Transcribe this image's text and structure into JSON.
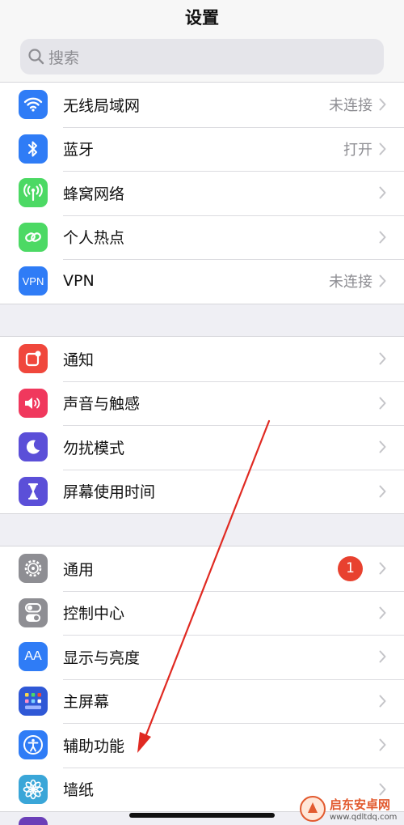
{
  "header": {
    "title": "设置"
  },
  "search": {
    "placeholder": "搜索"
  },
  "groups": [
    {
      "items": [
        {
          "label": "无线局域网",
          "value": "未连接",
          "icon": "wifi-icon",
          "color": "#2f7cf6"
        },
        {
          "label": "蓝牙",
          "value": "打开",
          "icon": "bluetooth-icon",
          "color": "#2f7cf6"
        },
        {
          "label": "蜂窝网络",
          "value": "",
          "icon": "antenna-icon",
          "color": "#4cd964"
        },
        {
          "label": "个人热点",
          "value": "",
          "icon": "hotspot-link-icon",
          "color": "#4cd964"
        },
        {
          "label": "VPN",
          "value": "未连接",
          "icon": "vpn-icon",
          "icon_text": "VPN",
          "color": "#2f7cf6"
        }
      ]
    },
    {
      "items": [
        {
          "label": "通知",
          "icon": "notification-icon",
          "color": "#f0473c"
        },
        {
          "label": "声音与触感",
          "icon": "speaker-icon",
          "color": "#f0385d"
        },
        {
          "label": "勿扰模式",
          "icon": "moon-icon",
          "color": "#5b4fd8"
        },
        {
          "label": "屏幕使用时间",
          "icon": "hourglass-icon",
          "color": "#5b4fd8"
        }
      ]
    },
    {
      "items": [
        {
          "label": "通用",
          "badge": "1",
          "icon": "gear-icon",
          "color": "#8e8e93"
        },
        {
          "label": "控制中心",
          "icon": "toggle-switches-icon",
          "color": "#8e8e93"
        },
        {
          "label": "显示与亮度",
          "icon": "text-size-icon",
          "icon_text": "AA",
          "color": "#2f7cf6"
        },
        {
          "label": "主屏幕",
          "icon": "home-grid-icon",
          "color": "#2f58d6"
        },
        {
          "label": "辅助功能",
          "icon": "accessibility-icon",
          "color": "#2f7cf6"
        },
        {
          "label": "墙纸",
          "icon": "flower-icon",
          "color": "#3aa6d8"
        }
      ]
    }
  ],
  "watermark": {
    "name": "启东安卓网",
    "url": "www.qdltdq.com"
  }
}
